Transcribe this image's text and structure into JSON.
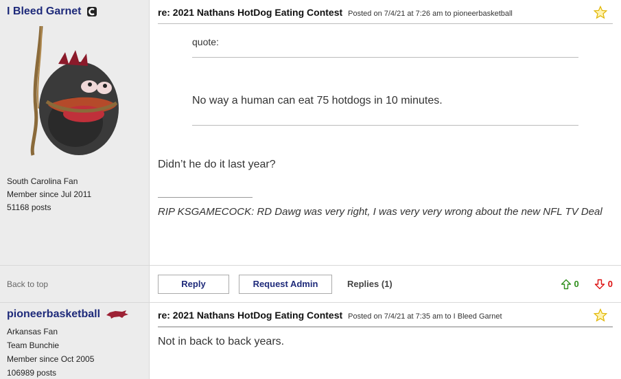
{
  "post1": {
    "author": {
      "name": "I Bleed Garnet",
      "team": "South Carolina Fan",
      "member_since": "Member since Jul 2011",
      "posts": "51168 posts"
    },
    "title": "re: 2021 Nathans HotDog Eating Contest",
    "posted": "Posted on 7/4/21 at 7:26 am to pioneerbasketball",
    "quote_label": "quote:",
    "quote_text": "No way a human can eat 75 hotdogs in 10 minutes.",
    "body": "Didn’t he do it last year?",
    "signature": "RIP KSGAMECOCK: RD Dawg was very right, I was very very wrong about the new NFL TV Deal"
  },
  "actions": {
    "back_to_top": "Back to top",
    "reply": "Reply",
    "request_admin": "Request Admin",
    "replies": "Replies (1)",
    "upvotes": "0",
    "downvotes": "0"
  },
  "post2": {
    "author": {
      "name": "pioneerbasketball",
      "team": "Arkansas Fan",
      "subtitle": "Team Bunchie",
      "member_since": "Member since Oct 2005",
      "posts": "106989 posts"
    },
    "title": "re: 2021 Nathans HotDog Eating Contest",
    "posted": "Posted on 7/4/21 at 7:35 am to I Bleed Garnet",
    "body": "Not in back to back years."
  },
  "colors": {
    "username": "#1e2a7a",
    "upvote": "#2f8f1c",
    "downvote": "#dd1111",
    "sidebar_bg": "#ececec"
  }
}
